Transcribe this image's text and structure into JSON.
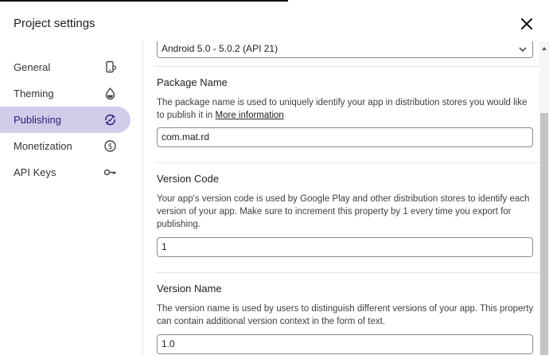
{
  "dialog": {
    "title": "Project settings"
  },
  "sidebar": {
    "items": [
      {
        "label": "General",
        "icon": "phone-settings-icon"
      },
      {
        "label": "Theming",
        "icon": "droplet-icon"
      },
      {
        "label": "Publishing",
        "icon": "publish-sync-icon",
        "active": true
      },
      {
        "label": "Monetization",
        "icon": "dollar-icon"
      },
      {
        "label": "API Keys",
        "icon": "key-icon"
      }
    ]
  },
  "publishing": {
    "min_sdk_value": "Android 5.0 - 5.0.2 (API 21)",
    "package_name": {
      "title": "Package Name",
      "description": "The package name is used to uniquely identify your app in distribution stores you would like to publish it in",
      "link_text": "More information",
      "value": "com.mat.rd"
    },
    "version_code": {
      "title": "Version Code",
      "description": "Your app's version code is used by Google Play and other distribution stores to identify each version of your app. Make sure to increment this property by 1 every time you export for publishing.",
      "value": "1"
    },
    "version_name": {
      "title": "Version Name",
      "description": "The version name is used by users to distinguish different versions of your app. This property can contain additional version context in the form of text.",
      "value": "1.0"
    }
  },
  "colors": {
    "active_nav_bg": "#d2cbe9",
    "active_nav_text": "#2b1f73"
  }
}
